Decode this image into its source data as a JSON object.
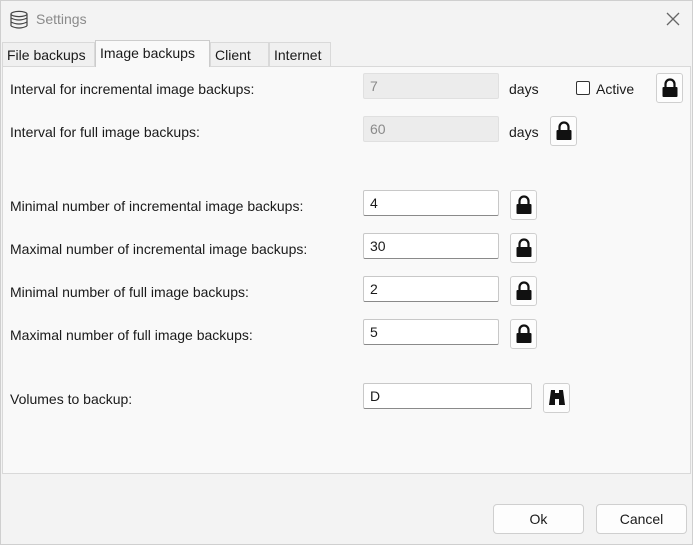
{
  "window": {
    "title": "Settings"
  },
  "tabs": [
    {
      "label": "File backups"
    },
    {
      "label": "Image backups"
    },
    {
      "label": "Client"
    },
    {
      "label": "Internet"
    }
  ],
  "image_backups": {
    "incremental_interval": {
      "label": "Interval for incremental image backups:",
      "value": "7",
      "unit": "days",
      "active_label": "Active"
    },
    "full_interval": {
      "label": "Interval for full image backups:",
      "value": "60",
      "unit": "days"
    },
    "min_incremental": {
      "label": "Minimal number of incremental image backups:",
      "value": "4"
    },
    "max_incremental": {
      "label": "Maximal number of incremental image backups:",
      "value": "30"
    },
    "min_full": {
      "label": "Minimal number of full image backups:",
      "value": "2"
    },
    "max_full": {
      "label": "Maximal number of full image backups:",
      "value": "5"
    },
    "volumes": {
      "label": "Volumes to backup:",
      "value": "D"
    }
  },
  "footer": {
    "ok_label": "Ok",
    "cancel_label": "Cancel"
  }
}
